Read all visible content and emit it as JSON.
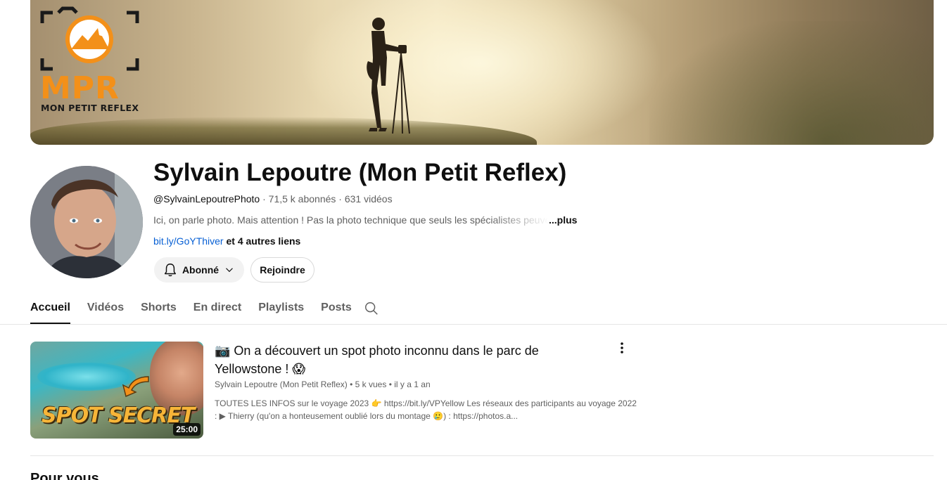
{
  "banner": {
    "logo_text": "MPR",
    "logo_subtitle": "MON PETIT REFLEX",
    "logo_color": "#f39019"
  },
  "channel": {
    "title": "Sylvain Lepoutre (Mon Petit Reflex)",
    "handle": "@SylvainLepoutrePhoto",
    "subscribers": "71,5 k abonnés",
    "video_count": "631 vidéos",
    "description": "Ici, on parle photo. Mais attention ! Pas la photo technique que seuls les spécialistes peuvent",
    "more_label": "...plus",
    "link_text": "bit.ly/GoYThiver",
    "other_links": "et 4 autres liens"
  },
  "buttons": {
    "subscribed_label": "Abonné",
    "join_label": "Rejoindre"
  },
  "tabs": [
    {
      "label": "Accueil",
      "active": true
    },
    {
      "label": "Vidéos"
    },
    {
      "label": "Shorts"
    },
    {
      "label": "En direct"
    },
    {
      "label": "Playlists"
    },
    {
      "label": "Posts"
    }
  ],
  "featured_video": {
    "title": "📷 On a découvert un spot photo inconnu dans le parc de Yellowstone ! 😱",
    "channel": "Sylvain Lepoutre (Mon Petit Reflex)",
    "views": "5 k vues",
    "age": "il y a 1 an",
    "description": "TOUTES LES INFOS sur le voyage 2023 👉 https://bit.ly/VPYellow Les réseaux des participants au voyage 2022 : ▶ Thierry (qu'on a honteusement oublié lors du montage 🥲) : https://photos.a...",
    "thumbnail_text": "SPOT SECRET",
    "duration": "25:00"
  },
  "section": {
    "title": "Pour vous"
  },
  "colors": {
    "link": "#065fd4",
    "text_primary": "#0f0f0f",
    "text_secondary": "#606060"
  }
}
